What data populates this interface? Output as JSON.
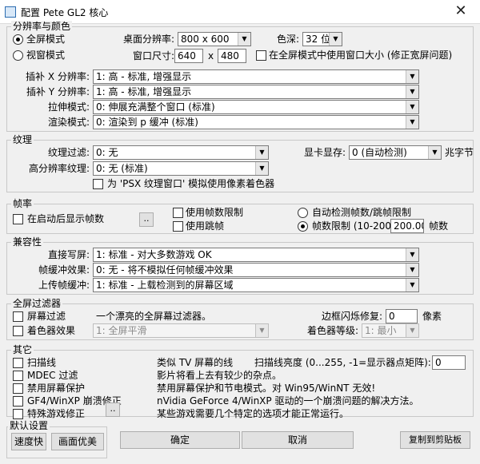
{
  "window": {
    "title": "配置 Pete GL2 核心",
    "close": "✕"
  },
  "resolution": {
    "group_title": "分辨率与颜色",
    "fullscreen_label": "全屏模式",
    "windowed_label": "视窗模式",
    "desktop_res_label": "桌面分辨率:",
    "desktop_res_value": "800  x  600",
    "color_label": "色深:",
    "color_value": "32 位",
    "window_size_label": "窗口尺寸:",
    "window_w": "640",
    "window_x": "x",
    "window_h": "480",
    "fullscreen_window_size_label": "在全屏模式中使用窗口大小 (修正宽屏问题)",
    "x_interp_label": "插补 X 分辨率:",
    "x_interp_value": "1: 高 - 标准, 增强显示",
    "y_interp_label": "插补 Y 分辨率:",
    "y_interp_value": "1: 高 - 标准, 增强显示",
    "stretch_label": "拉伸模式:",
    "stretch_value": "0: 伸展充满整个窗口 (标准)",
    "render_label": "渲染模式:",
    "render_value": "0: 渲染到 p 缓冲 (标准)"
  },
  "texture": {
    "group_title": "纹理",
    "filter_label": "纹理过滤:",
    "filter_value": "0: 无",
    "vram_label": "显卡显存:",
    "vram_value": "0 (自动检测)",
    "vram_unit": "兆字节",
    "hires_label": "高分辨率纹理:",
    "hires_value": "0: 无 (标准)",
    "psx_window_label": "为 'PSX 纹理窗口' 模拟使用像素着色器"
  },
  "framerate": {
    "group_title": "帧率",
    "show_fps_label": "在启动后显示帧数",
    "more_button": "..",
    "fps_limit_label": "使用帧数限制",
    "frame_skip_label": "使用跳帧",
    "auto_detect_label": "自动检测帧数/跳帧限制",
    "fps_limit_range_label": "帧数限制 (10-200)",
    "fps_limit_value": "200.00",
    "fps_unit": "帧数"
  },
  "compat": {
    "group_title": "兼容性",
    "offscreen_label": "直接写屏:",
    "offscreen_value": "1: 标准 - 对大多数游戏 OK",
    "framebuffer_effects_label": "帧缓冲效果:",
    "framebuffer_effects_value": "0: 无 - 将不模拟任何帧缓冲效果",
    "framebuffer_upload_label": "上传帧缓冲:",
    "framebuffer_upload_value": "1: 标准 - 上载检测到的屏幕区域"
  },
  "filters": {
    "group_title": "全屏过滤器",
    "screen_filter_label": "屏幕过滤",
    "screen_filter_desc": "一个漂亮的全屏幕过滤器。",
    "edge_label": "边框闪烁修复:",
    "edge_value": "0",
    "edge_unit": "像素",
    "shader_label": "着色器效果",
    "shader_value": "1: 全屏平滑",
    "shader_level_label": "着色器等级:",
    "shader_level_value": "1: 最小"
  },
  "misc": {
    "group_title": "其它",
    "scanlines_label": "扫描线",
    "scanlines_desc": "类似 TV 屏幕的线",
    "scanline_brightness_label": "扫描线亮度 (0...255, -1=显示器点矩阵):",
    "scanline_brightness_value": "0",
    "mdec_label": "MDEC 过滤",
    "mdec_desc": "影片将看上去有较少的杂点。",
    "screensaver_label": "禁用屏幕保护",
    "screensaver_desc": "禁用屏幕保护和节电模式。对 Win95/WinNT 无效!",
    "gf4_label": "GF4/WinXP 崩溃修正",
    "gf4_desc": "nVidia GeForce 4/WinXP 驱动的一个崩溃问题的解决方法。",
    "special_label": "特殊游戏修正",
    "special_more": "..",
    "special_desc": "某些游戏需要几个特定的选项才能正常运行。"
  },
  "defaults": {
    "group_title": "默认设置",
    "fast_button": "速度快",
    "nice_button": "画面优美"
  },
  "actions": {
    "ok_button": "确定",
    "cancel_button": "取消",
    "copy_button": "复制到剪贴板"
  }
}
